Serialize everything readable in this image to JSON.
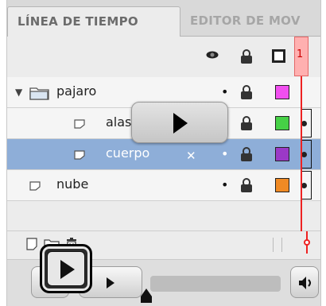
{
  "tabs": [
    {
      "label": "LÍNEA DE TIEMPO",
      "active": true
    },
    {
      "label": "EDITOR DE MOV",
      "active": false
    }
  ],
  "header": {
    "icons": [
      "eye-icon",
      "lock-icon",
      "outline-icon"
    ],
    "playhead_frame": "1"
  },
  "layers": [
    {
      "name": "pajaro",
      "type": "folder",
      "expanded": true,
      "color": "#f14ff0",
      "selected": false
    },
    {
      "name": "alas",
      "type": "layer",
      "color": "#46d146",
      "selected": false
    },
    {
      "name": "cuerpo",
      "type": "layer",
      "color": "#9b39c7",
      "selected": true
    },
    {
      "name": "nube",
      "type": "layer",
      "color": "#f08a24",
      "selected": false
    }
  ],
  "colors": {
    "selection": "#8eaed8",
    "playhead": "#ee2222",
    "tab_inactive_text": "#a6a6a6"
  },
  "toolbar": {
    "icons": [
      "new-layer-icon",
      "new-folder-icon",
      "trash-icon"
    ]
  },
  "video": {
    "controls": [
      "play-button",
      "progress-track",
      "volume-icon"
    ]
  },
  "overlay": {
    "play_icon": "play-icon"
  }
}
